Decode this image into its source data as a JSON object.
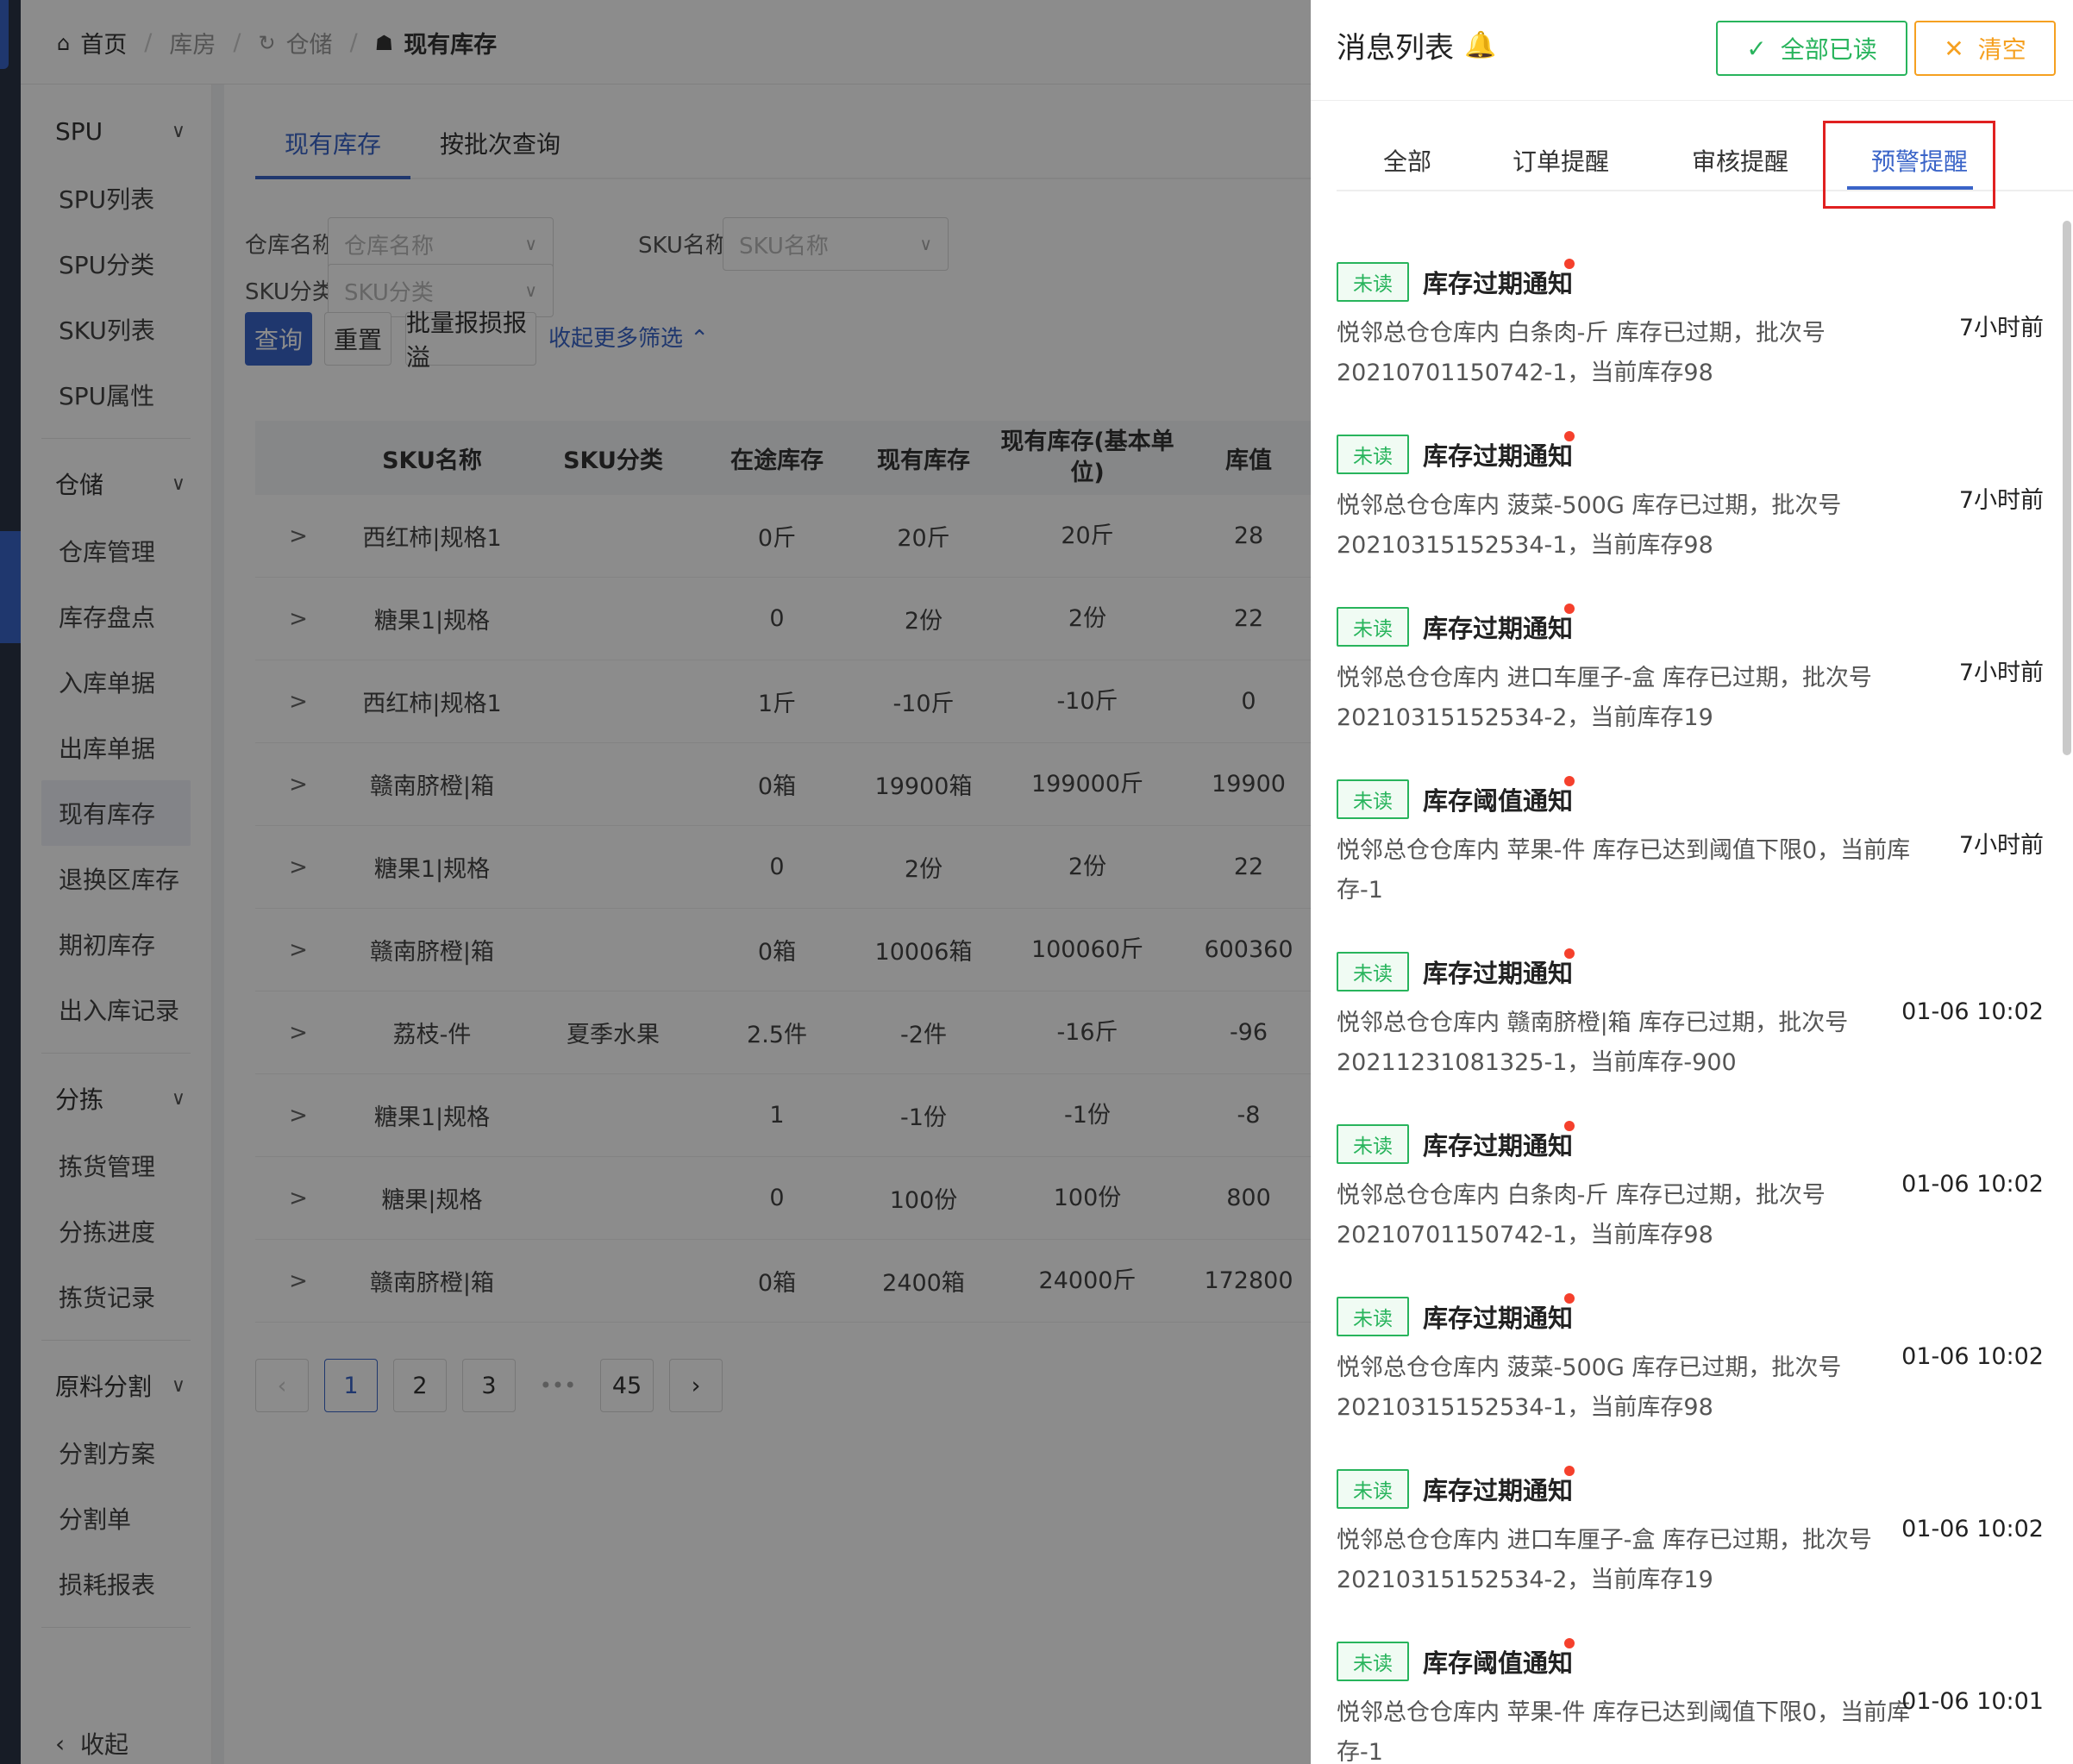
{
  "breadcrumb": [
    {
      "icon": "home-icon",
      "glyph": "⌂",
      "label": "首页"
    },
    {
      "icon": "",
      "glyph": "",
      "label": "库房"
    },
    {
      "icon": "warehouse-icon",
      "glyph": "↻",
      "label": "仓储"
    },
    {
      "icon": "stock-icon",
      "glyph": "☗",
      "label": "现有库存"
    }
  ],
  "sidebar": {
    "groups": [
      {
        "label": "SPU",
        "items": [
          "SPU列表",
          "SPU分类",
          "SKU列表",
          "SPU属性"
        ]
      },
      {
        "label": "仓储",
        "items": [
          "仓库管理",
          "库存盘点",
          "入库单据",
          "出库单据",
          "现有库存",
          "退换区库存",
          "期初库存",
          "出入库记录"
        ]
      },
      {
        "label": "分拣",
        "items": [
          "拣货管理",
          "分拣进度",
          "拣货记录"
        ]
      },
      {
        "label": "原料分割",
        "items": [
          "分割方案",
          "分割单",
          "损耗报表"
        ]
      }
    ],
    "active_item": "现有库存",
    "collapse_label": "收起"
  },
  "main": {
    "tabs": [
      "现有库存",
      "按批次查询"
    ],
    "active_tab": "现有库存",
    "filters": {
      "warehouse_label": "仓库名称:",
      "warehouse_placeholder": "仓库名称",
      "sku_name_label": "SKU名称:",
      "sku_name_placeholder": "SKU名称",
      "sku_cat_label": "SKU分类:",
      "sku_cat_placeholder": "SKU分类"
    },
    "buttons": {
      "query": "查询",
      "reset": "重置",
      "batch_loss": "批量报损报溢",
      "collapse_filters": "收起更多筛选 ⌃"
    },
    "table": {
      "headers": [
        "",
        "SKU名称",
        "SKU分类",
        "在途库存",
        "现有库存",
        "现有库存(基本单位)",
        "库值"
      ],
      "rows": [
        [
          ">",
          "西红柿|规格1",
          "",
          "0斤",
          "20斤",
          "20斤",
          "28"
        ],
        [
          ">",
          "糖果1|规格",
          "",
          "0",
          "2份",
          "2份",
          "22"
        ],
        [
          ">",
          "西红柿|规格1",
          "",
          "1斤",
          "-10斤",
          "-10斤",
          "0"
        ],
        [
          ">",
          "赣南脐橙|箱",
          "",
          "0箱",
          "19900箱",
          "199000斤",
          "19900"
        ],
        [
          ">",
          "糖果1|规格",
          "",
          "0",
          "2份",
          "2份",
          "22"
        ],
        [
          ">",
          "赣南脐橙|箱",
          "",
          "0箱",
          "10006箱",
          "100060斤",
          "600360"
        ],
        [
          ">",
          "荔枝-件",
          "夏季水果",
          "2.5件",
          "-2件",
          "-16斤",
          "-96"
        ],
        [
          ">",
          "糖果1|规格",
          "",
          "1",
          "-1份",
          "-1份",
          "-8"
        ],
        [
          ">",
          "糖果|规格",
          "",
          "0",
          "100份",
          "100份",
          "800"
        ],
        [
          ">",
          "赣南脐橙|箱",
          "",
          "0箱",
          "2400箱",
          "24000斤",
          "172800"
        ]
      ]
    },
    "pagination": {
      "prev": "‹",
      "pages": [
        "1",
        "2",
        "3"
      ],
      "dots": "•••",
      "last": "45",
      "next": "›",
      "current": "1"
    }
  },
  "drawer": {
    "title": "消息列表",
    "bell_icon": "bell-icon",
    "mark_all_read": "全部已读",
    "clear": "清空",
    "check_glyph": "✓",
    "close_glyph": "✕",
    "tabs": [
      "全部",
      "订单提醒",
      "审核提醒",
      "预警提醒"
    ],
    "active_tab": "预警提醒",
    "messages": [
      {
        "tag": "未读",
        "title": "库存过期通知",
        "body": "悦邻总仓仓库内 白条肉-斤 库存已过期，批次号20210701150742-1，当前库存98",
        "time": "7小时前"
      },
      {
        "tag": "未读",
        "title": "库存过期通知",
        "body": "悦邻总仓仓库内 菠菜-500G 库存已过期，批次号20210315152534-1，当前库存98",
        "time": "7小时前"
      },
      {
        "tag": "未读",
        "title": "库存过期通知",
        "body": "悦邻总仓仓库内 进口车厘子-盒 库存已过期，批次号20210315152534-2，当前库存19",
        "time": "7小时前"
      },
      {
        "tag": "未读",
        "title": "库存阈值通知",
        "body": "悦邻总仓仓库内 苹果-件 库存已达到阈值下限0，当前库存-1",
        "time": "7小时前"
      },
      {
        "tag": "未读",
        "title": "库存过期通知",
        "body": "悦邻总仓仓库内 赣南脐橙|箱 库存已过期，批次号20211231081325-1，当前库存-900",
        "time": "01-06 10:02"
      },
      {
        "tag": "未读",
        "title": "库存过期通知",
        "body": "悦邻总仓仓库内 白条肉-斤 库存已过期，批次号20210701150742-1，当前库存98",
        "time": "01-06 10:02"
      },
      {
        "tag": "未读",
        "title": "库存过期通知",
        "body": "悦邻总仓仓库内 菠菜-500G 库存已过期，批次号20210315152534-1，当前库存98",
        "time": "01-06 10:02"
      },
      {
        "tag": "未读",
        "title": "库存过期通知",
        "body": "悦邻总仓仓库内 进口车厘子-盒 库存已过期，批次号20210315152534-2，当前库存19",
        "time": "01-06 10:02"
      },
      {
        "tag": "未读",
        "title": "库存阈值通知",
        "body": "悦邻总仓仓库内 苹果-件 库存已达到阈值下限0，当前库存-1",
        "time": "01-06 10:01"
      }
    ]
  },
  "colors": {
    "primary": "#3a64c8",
    "success": "#28b45c",
    "warning": "#f5a020",
    "highlight": "#e02020",
    "unread_dot": "#f5402c"
  }
}
